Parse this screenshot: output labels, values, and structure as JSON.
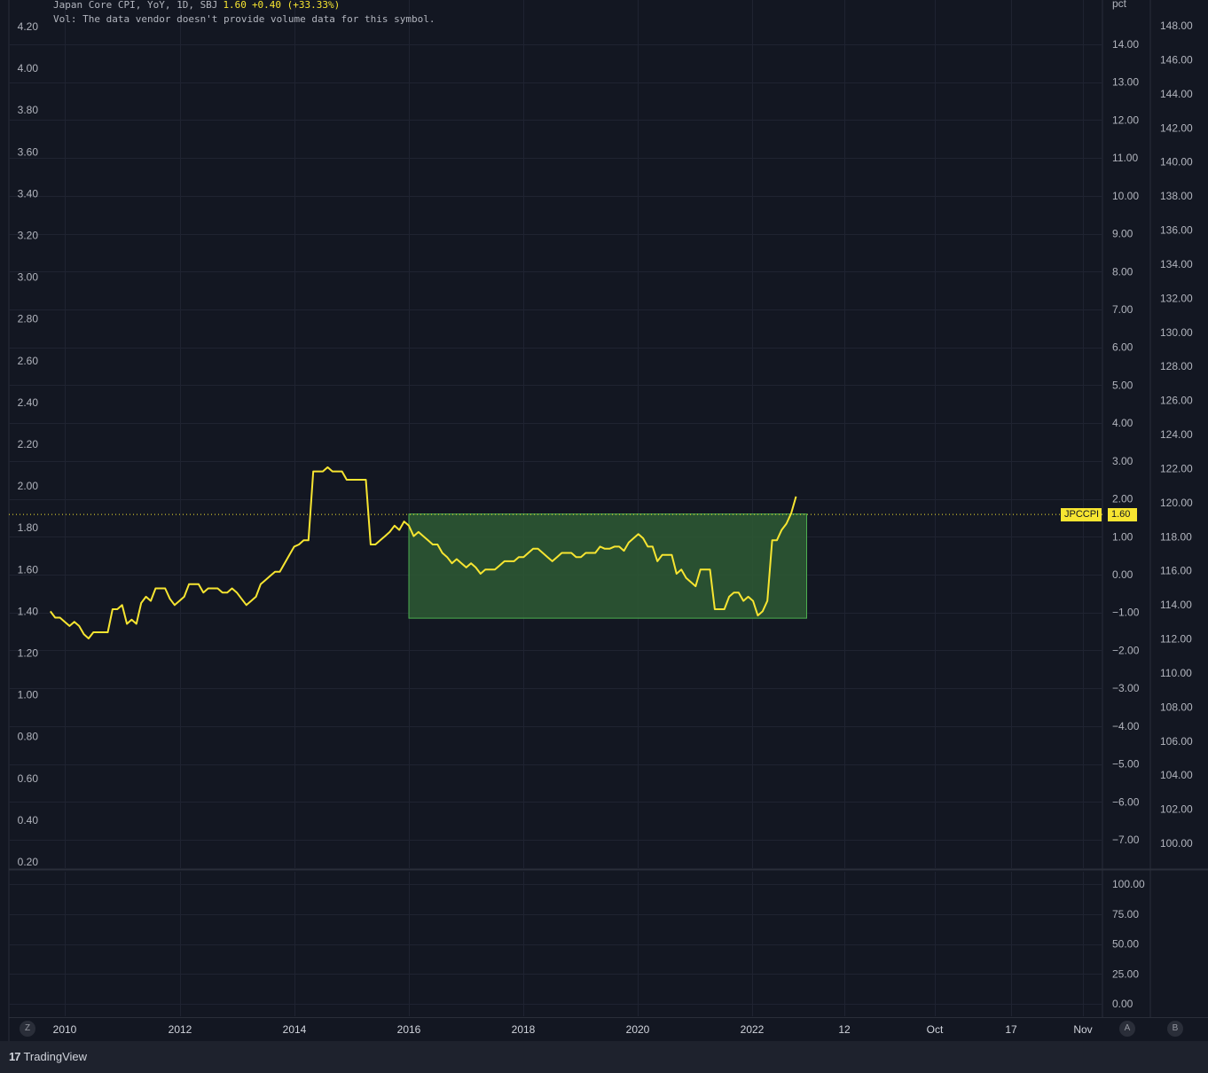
{
  "legend": {
    "title": "Japan Core CPI, YoY, 1D, SBJ",
    "last": "1.60",
    "change": "+0.40 (+33.33%)",
    "volume_note": "Vol: The data vendor doesn't provide volume data for this symbol."
  },
  "price_tag": {
    "symbol": "JPCCPI",
    "value": "1.60",
    "color": "#f7e531"
  },
  "pane_buttons": {
    "left": "Z",
    "right_a": "A",
    "right_b": "B"
  },
  "footer": {
    "brand": "TradingView",
    "logo": "17"
  },
  "colors": {
    "background": "#131722",
    "grid": "#1f2331",
    "line": "#f7e531",
    "box_fill": "#2e5a34",
    "box_border": "#4caf50"
  },
  "chart_data": {
    "type": "line",
    "series": [
      {
        "name": "Japan Core CPI, YoY, 1D, SBJ",
        "points": [
          [
            "2009-10",
            1.4
          ],
          [
            "2009-11",
            1.37
          ],
          [
            "2009-12",
            1.37
          ],
          [
            "2010-01",
            1.35
          ],
          [
            "2010-02",
            1.33
          ],
          [
            "2010-03",
            1.35
          ],
          [
            "2010-04",
            1.33
          ],
          [
            "2010-05",
            1.29
          ],
          [
            "2010-06",
            1.27
          ],
          [
            "2010-07",
            1.3
          ],
          [
            "2010-08",
            1.3
          ],
          [
            "2010-09",
            1.3
          ],
          [
            "2010-10",
            1.3
          ],
          [
            "2010-11",
            1.41
          ],
          [
            "2010-12",
            1.41
          ],
          [
            "2011-01",
            1.43
          ],
          [
            "2011-02",
            1.34
          ],
          [
            "2011-03",
            1.36
          ],
          [
            "2011-04",
            1.34
          ],
          [
            "2011-05",
            1.44
          ],
          [
            "2011-06",
            1.47
          ],
          [
            "2011-07",
            1.45
          ],
          [
            "2011-08",
            1.51
          ],
          [
            "2011-09",
            1.51
          ],
          [
            "2011-10",
            1.51
          ],
          [
            "2011-11",
            1.46
          ],
          [
            "2011-12",
            1.43
          ],
          [
            "2012-01",
            1.45
          ],
          [
            "2012-02",
            1.47
          ],
          [
            "2012-03",
            1.53
          ],
          [
            "2012-04",
            1.53
          ],
          [
            "2012-05",
            1.53
          ],
          [
            "2012-06",
            1.49
          ],
          [
            "2012-07",
            1.51
          ],
          [
            "2012-08",
            1.51
          ],
          [
            "2012-09",
            1.51
          ],
          [
            "2012-10",
            1.49
          ],
          [
            "2012-11",
            1.49
          ],
          [
            "2012-12",
            1.51
          ],
          [
            "2013-01",
            1.49
          ],
          [
            "2013-02",
            1.46
          ],
          [
            "2013-03",
            1.43
          ],
          [
            "2013-04",
            1.45
          ],
          [
            "2013-05",
            1.47
          ],
          [
            "2013-06",
            1.53
          ],
          [
            "2013-07",
            1.55
          ],
          [
            "2013-08",
            1.57
          ],
          [
            "2013-09",
            1.59
          ],
          [
            "2013-10",
            1.59
          ],
          [
            "2013-11",
            1.63
          ],
          [
            "2013-12",
            1.67
          ],
          [
            "2014-01",
            1.71
          ],
          [
            "2014-02",
            1.72
          ],
          [
            "2014-03",
            1.74
          ],
          [
            "2014-04",
            1.74
          ],
          [
            "2014-05",
            2.07
          ],
          [
            "2014-06",
            2.07
          ],
          [
            "2014-07",
            2.07
          ],
          [
            "2014-08",
            2.09
          ],
          [
            "2014-09",
            2.07
          ],
          [
            "2014-10",
            2.07
          ],
          [
            "2014-11",
            2.07
          ],
          [
            "2014-12",
            2.03
          ],
          [
            "2015-01",
            2.03
          ],
          [
            "2015-02",
            2.03
          ],
          [
            "2015-03",
            2.03
          ],
          [
            "2015-04",
            2.03
          ],
          [
            "2015-05",
            1.72
          ],
          [
            "2015-06",
            1.72
          ],
          [
            "2015-07",
            1.74
          ],
          [
            "2015-08",
            1.76
          ],
          [
            "2015-09",
            1.78
          ],
          [
            "2015-10",
            1.81
          ],
          [
            "2015-11",
            1.79
          ],
          [
            "2015-12",
            1.83
          ],
          [
            "2016-01",
            1.81
          ],
          [
            "2016-02",
            1.76
          ],
          [
            "2016-03",
            1.78
          ],
          [
            "2016-04",
            1.76
          ],
          [
            "2016-05",
            1.74
          ],
          [
            "2016-06",
            1.72
          ],
          [
            "2016-07",
            1.72
          ],
          [
            "2016-08",
            1.68
          ],
          [
            "2016-09",
            1.66
          ],
          [
            "2016-10",
            1.63
          ],
          [
            "2016-11",
            1.65
          ],
          [
            "2016-12",
            1.63
          ],
          [
            "2017-01",
            1.61
          ],
          [
            "2017-02",
            1.63
          ],
          [
            "2017-03",
            1.61
          ],
          [
            "2017-04",
            1.58
          ],
          [
            "2017-05",
            1.6
          ],
          [
            "2017-06",
            1.6
          ],
          [
            "2017-07",
            1.6
          ],
          [
            "2017-08",
            1.62
          ],
          [
            "2017-09",
            1.64
          ],
          [
            "2017-10",
            1.64
          ],
          [
            "2017-11",
            1.64
          ],
          [
            "2017-12",
            1.66
          ],
          [
            "2018-01",
            1.66
          ],
          [
            "2018-02",
            1.68
          ],
          [
            "2018-03",
            1.7
          ],
          [
            "2018-04",
            1.7
          ],
          [
            "2018-05",
            1.68
          ],
          [
            "2018-06",
            1.66
          ],
          [
            "2018-07",
            1.64
          ],
          [
            "2018-08",
            1.66
          ],
          [
            "2018-09",
            1.68
          ],
          [
            "2018-10",
            1.68
          ],
          [
            "2018-11",
            1.68
          ],
          [
            "2018-12",
            1.66
          ],
          [
            "2019-01",
            1.66
          ],
          [
            "2019-02",
            1.68
          ],
          [
            "2019-03",
            1.68
          ],
          [
            "2019-04",
            1.68
          ],
          [
            "2019-05",
            1.71
          ],
          [
            "2019-06",
            1.7
          ],
          [
            "2019-07",
            1.7
          ],
          [
            "2019-08",
            1.71
          ],
          [
            "2019-09",
            1.71
          ],
          [
            "2019-10",
            1.69
          ],
          [
            "2019-11",
            1.73
          ],
          [
            "2019-12",
            1.75
          ],
          [
            "2020-01",
            1.77
          ],
          [
            "2020-02",
            1.75
          ],
          [
            "2020-03",
            1.71
          ],
          [
            "2020-04",
            1.71
          ],
          [
            "2020-05",
            1.64
          ],
          [
            "2020-06",
            1.67
          ],
          [
            "2020-07",
            1.67
          ],
          [
            "2020-08",
            1.67
          ],
          [
            "2020-09",
            1.58
          ],
          [
            "2020-10",
            1.6
          ],
          [
            "2020-11",
            1.56
          ],
          [
            "2020-12",
            1.54
          ],
          [
            "2021-01",
            1.52
          ],
          [
            "2021-02",
            1.6
          ],
          [
            "2021-03",
            1.6
          ],
          [
            "2021-04",
            1.6
          ],
          [
            "2021-05",
            1.41
          ],
          [
            "2021-06",
            1.41
          ],
          [
            "2021-07",
            1.41
          ],
          [
            "2021-08",
            1.47
          ],
          [
            "2021-09",
            1.49
          ],
          [
            "2021-10",
            1.49
          ],
          [
            "2021-11",
            1.45
          ],
          [
            "2021-12",
            1.47
          ],
          [
            "2022-01",
            1.45
          ],
          [
            "2022-02",
            1.38
          ],
          [
            "2022-03",
            1.4
          ],
          [
            "2022-04",
            1.45
          ],
          [
            "2022-05",
            1.74
          ],
          [
            "2022-06",
            1.74
          ],
          [
            "2022-07",
            1.79
          ],
          [
            "2022-08",
            1.82
          ],
          [
            "2022-09",
            1.87
          ],
          [
            "2022-10",
            1.95
          ]
        ]
      }
    ],
    "last_value_label": "1.60",
    "annotation_box": {
      "start": "2016-01",
      "end": "2022-10",
      "pct_top": 1.6,
      "pct_bottom": -1.15
    },
    "x_ticks": [
      "2010",
      "2012",
      "2014",
      "2016",
      "2018",
      "2020",
      "2022",
      "12",
      "Oct",
      "17",
      "Nov"
    ],
    "left_axis": {
      "ticks": [
        "4.20",
        "4.00",
        "3.80",
        "3.60",
        "3.40",
        "3.20",
        "3.00",
        "2.80",
        "2.60",
        "2.40",
        "2.20",
        "2.00",
        "1.80",
        "1.60",
        "1.40",
        "1.20",
        "1.00",
        "0.80",
        "0.60",
        "0.40",
        "0.20"
      ],
      "range": [
        0.2,
        4.2
      ]
    },
    "pct_axis": {
      "label": "pct",
      "ticks": [
        "14.00",
        "13.00",
        "12.00",
        "11.00",
        "10.00",
        "9.00",
        "8.00",
        "7.00",
        "6.00",
        "5.00",
        "4.00",
        "3.00",
        "2.00",
        "1.00",
        "0.00",
        "−1.00",
        "−2.00",
        "−3.00",
        "−4.00",
        "−5.00",
        "−6.00",
        "−7.00"
      ],
      "range": [
        -7,
        14
      ]
    },
    "right_axis": {
      "ticks": [
        "148.00",
        "146.00",
        "144.00",
        "142.00",
        "140.00",
        "138.00",
        "136.00",
        "134.00",
        "132.00",
        "130.00",
        "128.00",
        "126.00",
        "124.00",
        "122.00",
        "120.00",
        "118.00",
        "116.00",
        "114.00",
        "112.00",
        "110.00",
        "108.00",
        "106.00",
        "104.00",
        "102.00",
        "100.00"
      ],
      "range": [
        100,
        148
      ]
    },
    "lower_pane_axis": {
      "ticks": [
        "100.00",
        "75.00",
        "50.00",
        "25.00",
        "0.00"
      ],
      "range": [
        0,
        100
      ]
    },
    "grid": true
  }
}
